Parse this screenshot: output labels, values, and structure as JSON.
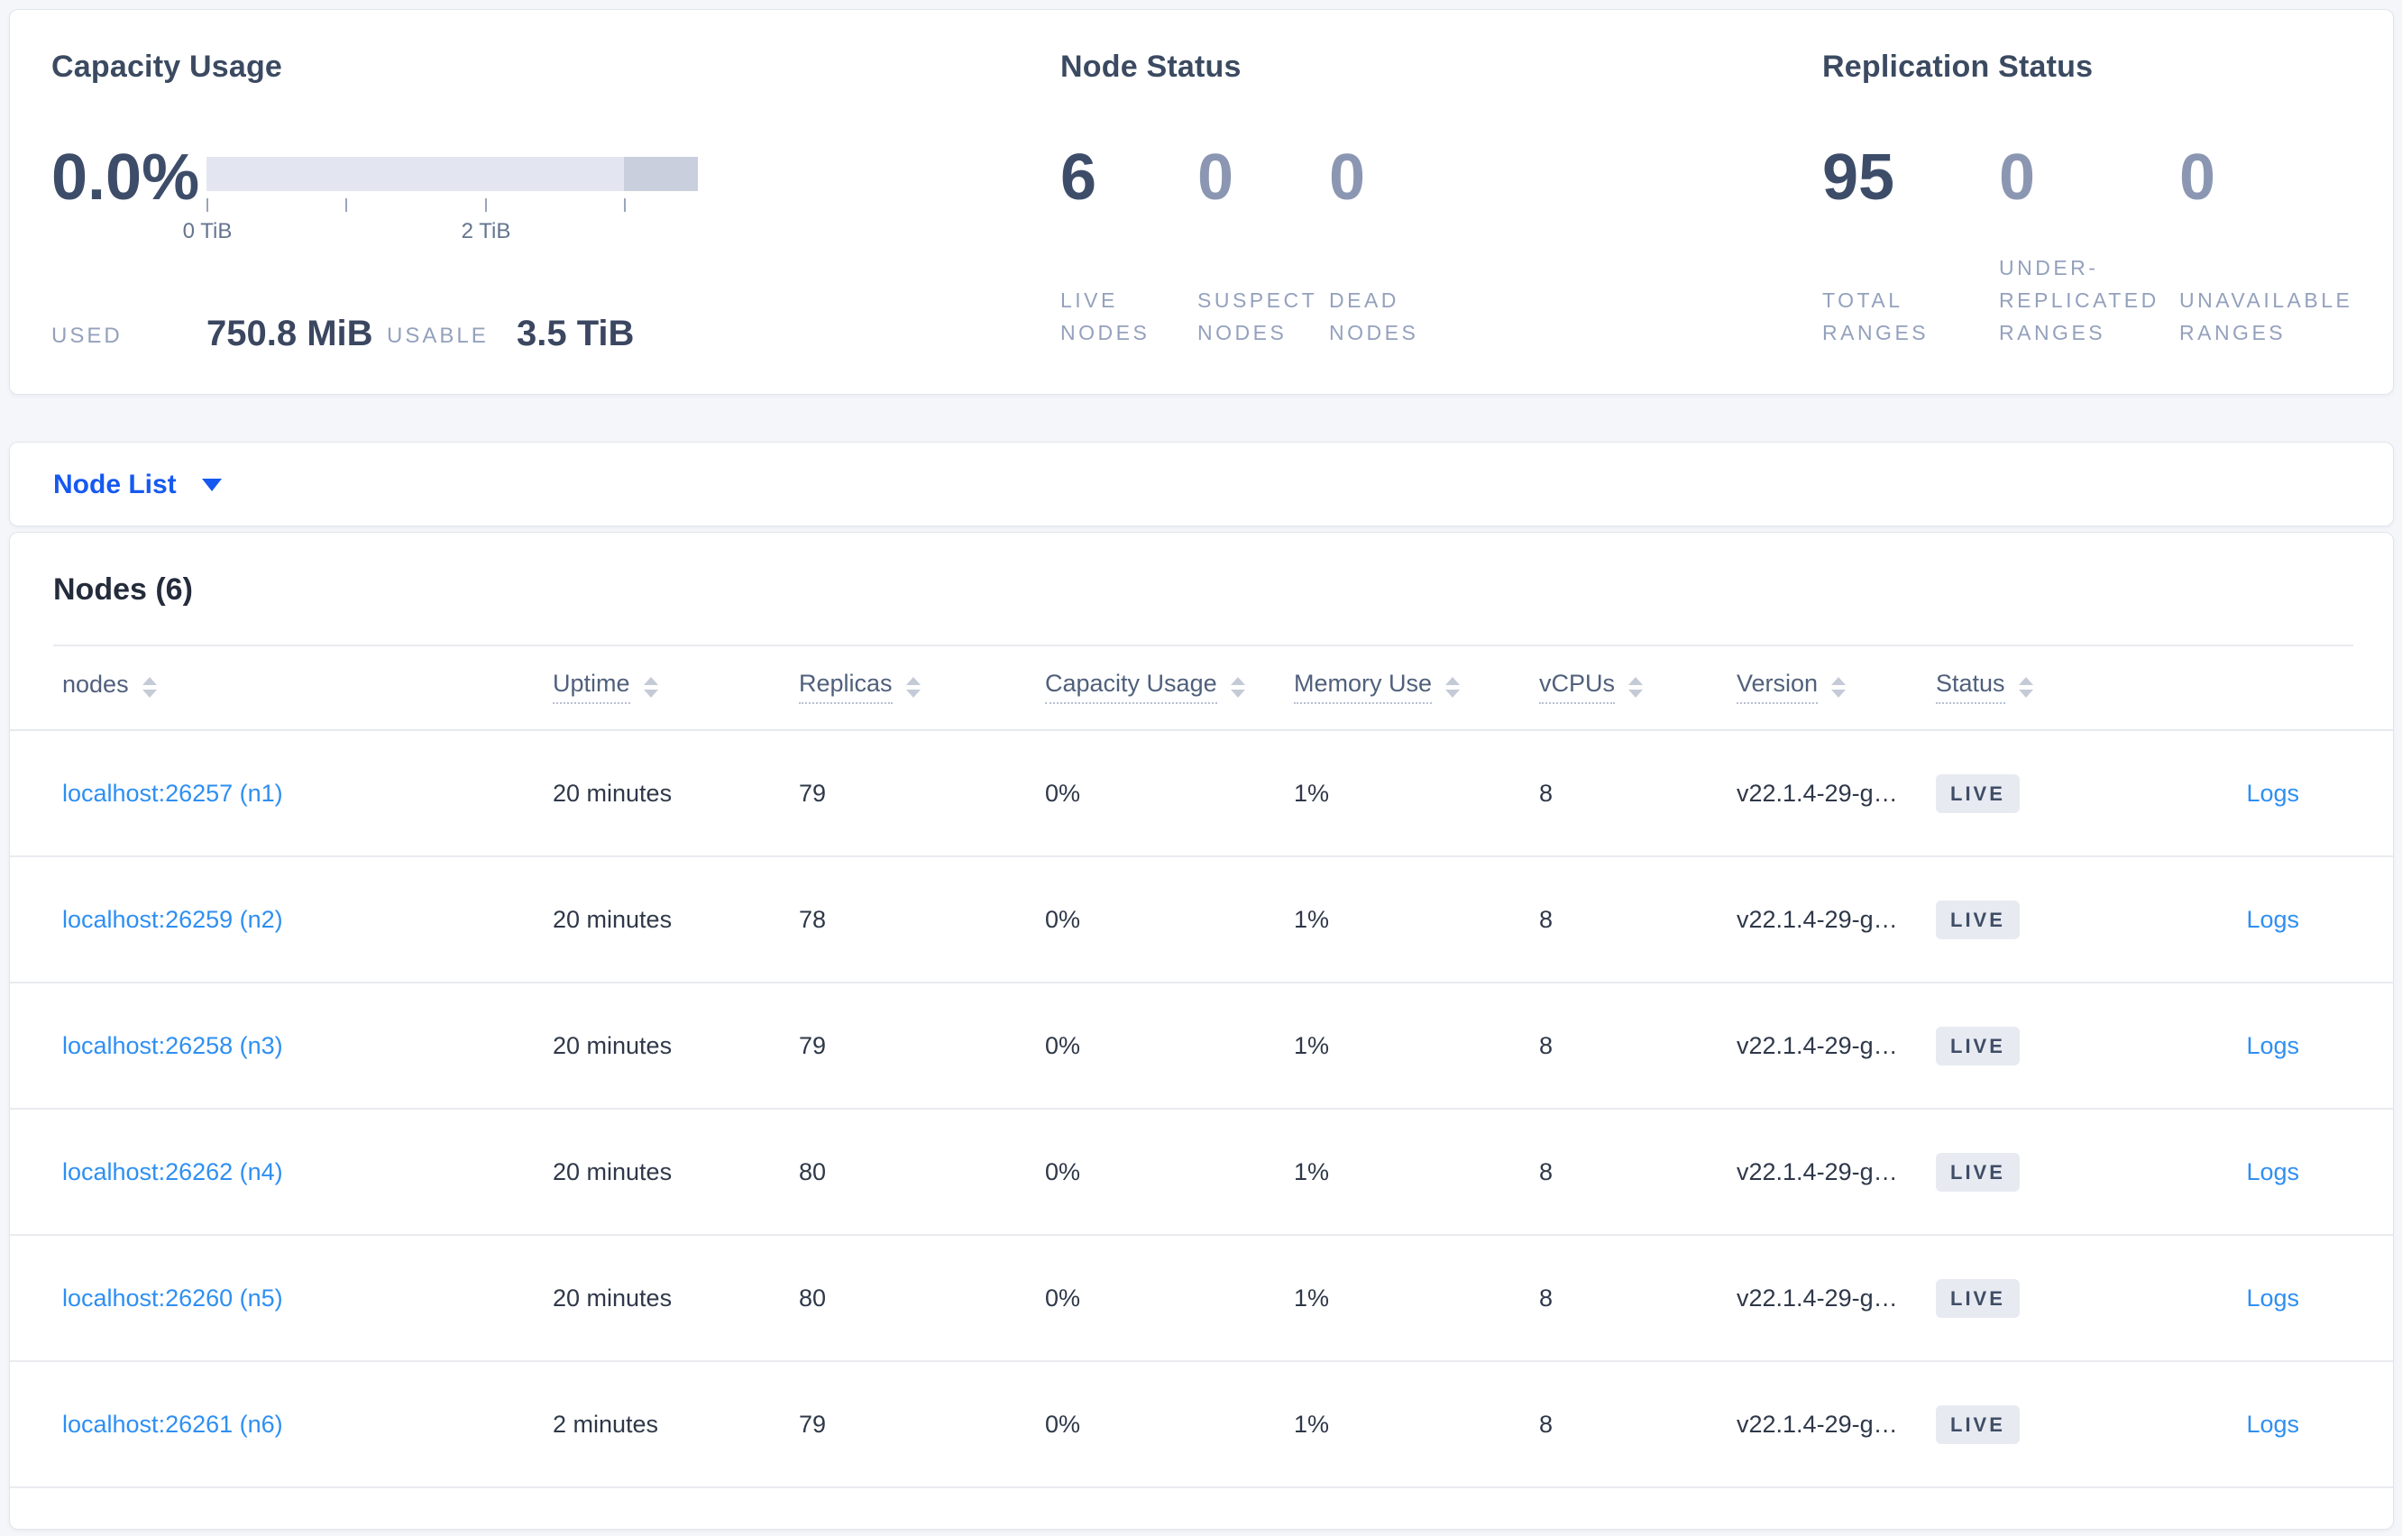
{
  "capacity": {
    "title": "Capacity Usage",
    "percent": "0.0%",
    "ticks": [
      "0 TiB",
      "2 TiB"
    ],
    "used_label": "USED",
    "used_value": "750.8 MiB",
    "usable_label": "USABLE",
    "usable_value": "3.5 TiB"
  },
  "node_status": {
    "title": "Node Status",
    "stats": [
      {
        "value": "6",
        "label": "LIVE NODES"
      },
      {
        "value": "0",
        "label": "SUSPECT NODES"
      },
      {
        "value": "0",
        "label": "DEAD NODES"
      }
    ]
  },
  "replication_status": {
    "title": "Replication Status",
    "stats": [
      {
        "value": "95",
        "label": "TOTAL RANGES"
      },
      {
        "value": "0",
        "label": "UNDER-REPLICATED RANGES"
      },
      {
        "value": "0",
        "label": "UNAVAILABLE RANGES"
      }
    ]
  },
  "node_list": {
    "dropdown_label": "Node List"
  },
  "nodes_table": {
    "title": "Nodes (6)",
    "columns": [
      {
        "id": "nodes",
        "label": "nodes"
      },
      {
        "id": "uptime",
        "label": "Uptime"
      },
      {
        "id": "replicas",
        "label": "Replicas"
      },
      {
        "id": "capacity",
        "label": "Capacity Usage"
      },
      {
        "id": "memory",
        "label": "Memory Use"
      },
      {
        "id": "vcpus",
        "label": "vCPUs"
      },
      {
        "id": "version",
        "label": "Version"
      },
      {
        "id": "status",
        "label": "Status"
      }
    ],
    "logs_label": "Logs",
    "rows": [
      {
        "node": "localhost:26257 (n1)",
        "uptime": "20 minutes",
        "replicas": "79",
        "capacity": "0%",
        "memory": "1%",
        "vcpus": "8",
        "version": "v22.1.4-29-g…",
        "status": "LIVE"
      },
      {
        "node": "localhost:26259 (n2)",
        "uptime": "20 minutes",
        "replicas": "78",
        "capacity": "0%",
        "memory": "1%",
        "vcpus": "8",
        "version": "v22.1.4-29-g…",
        "status": "LIVE"
      },
      {
        "node": "localhost:26258 (n3)",
        "uptime": "20 minutes",
        "replicas": "79",
        "capacity": "0%",
        "memory": "1%",
        "vcpus": "8",
        "version": "v22.1.4-29-g…",
        "status": "LIVE"
      },
      {
        "node": "localhost:26262 (n4)",
        "uptime": "20 minutes",
        "replicas": "80",
        "capacity": "0%",
        "memory": "1%",
        "vcpus": "8",
        "version": "v22.1.4-29-g…",
        "status": "LIVE"
      },
      {
        "node": "localhost:26260 (n5)",
        "uptime": "20 minutes",
        "replicas": "80",
        "capacity": "0%",
        "memory": "1%",
        "vcpus": "8",
        "version": "v22.1.4-29-g…",
        "status": "LIVE"
      },
      {
        "node": "localhost:26261 (n6)",
        "uptime": "2 minutes",
        "replicas": "79",
        "capacity": "0%",
        "memory": "1%",
        "vcpus": "8",
        "version": "v22.1.4-29-g…",
        "status": "LIVE"
      }
    ]
  }
}
